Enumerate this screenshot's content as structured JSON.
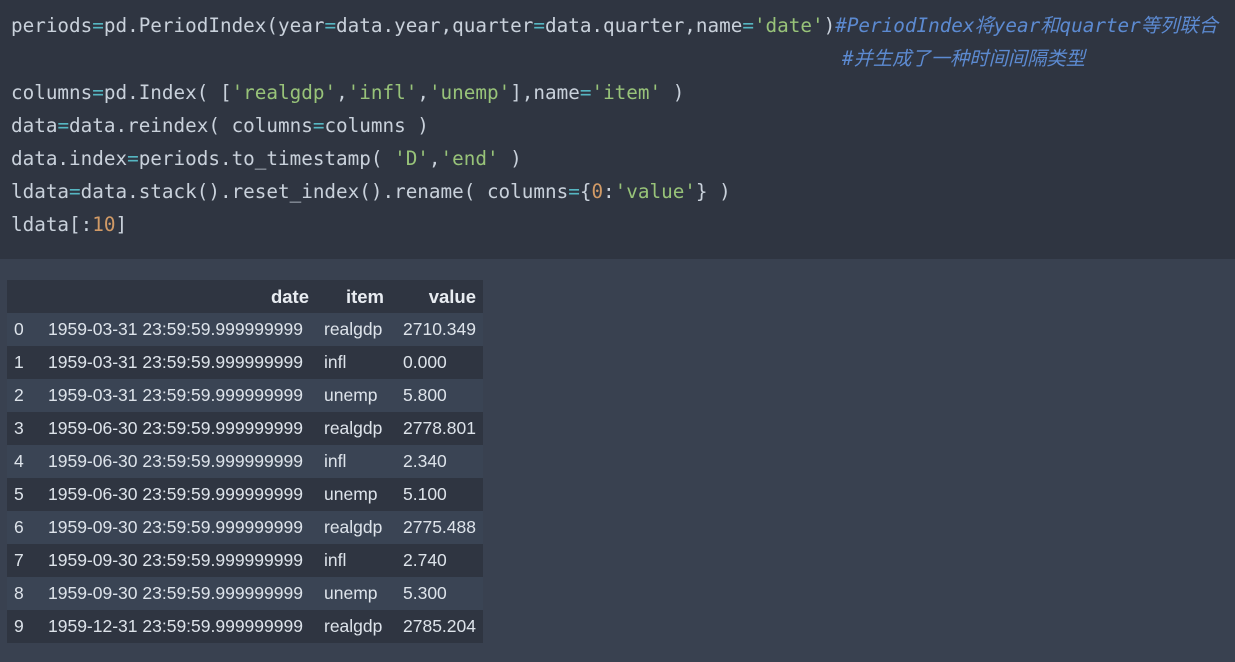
{
  "code": {
    "line1": {
      "t1": "periods",
      "t2": "=",
      "t3": "pd.PeriodIndex(year",
      "t4": "=",
      "t5": "data.year,quarter",
      "t6": "=",
      "t7": "data.quarter,name",
      "t8": "=",
      "t9": "'date'",
      "t10": ")",
      "t11": "#PeriodIndex将year和quarter等列联合"
    },
    "line2": {
      "t1": "#并生成了一种时间间隔类型"
    },
    "line3": {
      "t1": "columns",
      "t2": "=",
      "t3": "pd.Index( [",
      "t4": "'realgdp'",
      "t5": ",",
      "t6": "'infl'",
      "t7": ",",
      "t8": "'unemp'",
      "t9": "],name",
      "t10": "=",
      "t11": "'item'",
      "t12": " )"
    },
    "line4": {
      "t1": "data",
      "t2": "=",
      "t3": "data.reindex( columns",
      "t4": "=",
      "t5": "columns )"
    },
    "line5": {
      "t1": "data.index",
      "t2": "=",
      "t3": "periods.to_timestamp( ",
      "t4": "'D'",
      "t5": ",",
      "t6": "'end'",
      "t7": " )"
    },
    "line6": {
      "t1": "ldata",
      "t2": "=",
      "t3": "data.stack().reset_index().rename( columns",
      "t4": "=",
      "t5": "{",
      "t6": "0",
      "t7": ":",
      "t8": "'value'",
      "t9": "} )"
    },
    "line7": {
      "t1": "ldata[:",
      "t2": "10",
      "t3": "]"
    }
  },
  "table": {
    "headers": {
      "index": "",
      "date": "date",
      "item": "item",
      "value": "value"
    },
    "rows": [
      {
        "idx": "0",
        "date": "1959-03-31 23:59:59.999999999",
        "item": "realgdp",
        "value": "2710.349"
      },
      {
        "idx": "1",
        "date": "1959-03-31 23:59:59.999999999",
        "item": "infl",
        "value": "0.000"
      },
      {
        "idx": "2",
        "date": "1959-03-31 23:59:59.999999999",
        "item": "unemp",
        "value": "5.800"
      },
      {
        "idx": "3",
        "date": "1959-06-30 23:59:59.999999999",
        "item": "realgdp",
        "value": "2778.801"
      },
      {
        "idx": "4",
        "date": "1959-06-30 23:59:59.999999999",
        "item": "infl",
        "value": "2.340"
      },
      {
        "idx": "5",
        "date": "1959-06-30 23:59:59.999999999",
        "item": "unemp",
        "value": "5.100"
      },
      {
        "idx": "6",
        "date": "1959-09-30 23:59:59.999999999",
        "item": "realgdp",
        "value": "2775.488"
      },
      {
        "idx": "7",
        "date": "1959-09-30 23:59:59.999999999",
        "item": "infl",
        "value": "2.740"
      },
      {
        "idx": "8",
        "date": "1959-09-30 23:59:59.999999999",
        "item": "unemp",
        "value": "5.300"
      },
      {
        "idx": "9",
        "date": "1959-12-31 23:59:59.999999999",
        "item": "realgdp",
        "value": "2785.204"
      }
    ]
  },
  "colors": {
    "code_background": "#2f3541",
    "output_background": "#394150",
    "operator": "#56b6c2",
    "string": "#98c379",
    "number": "#d19a66",
    "comment": "#5c8ad1"
  }
}
